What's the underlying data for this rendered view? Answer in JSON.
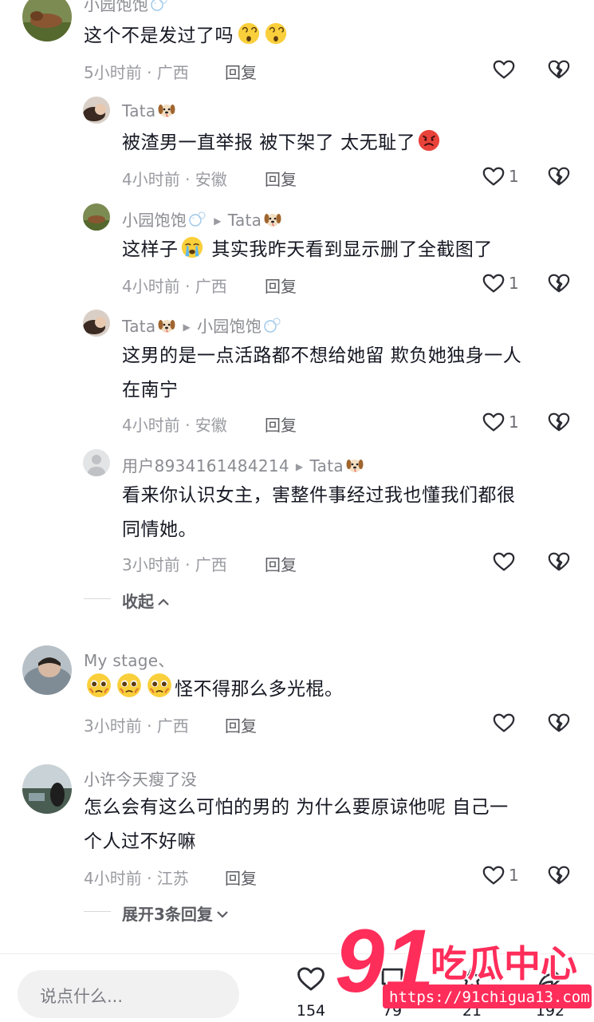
{
  "comments": [
    {
      "name": "小园饱饱",
      "text": "这个不是发过了吗",
      "time": "5小时前 · 广西",
      "reply": "回复"
    },
    {
      "name": "Tata",
      "text": "被渣男一直举报 被下架了 太无耻了",
      "time": "4小时前 · 安徽",
      "reply": "回复",
      "likes": "1"
    },
    {
      "name": "小园饱饱",
      "reply_to": "Tata",
      "text": "这样子",
      "text2": "其实我昨天看到显示删了全截图了",
      "time": "4小时前 · 广西",
      "reply": "回复",
      "likes": "1"
    },
    {
      "name": "Tata",
      "reply_to": "小园饱饱",
      "text_l1": "这男的是一点活路都不想给她留 欺负她独身一人",
      "text_l2": "在南宁",
      "time": "4小时前 · 安徽",
      "reply": "回复",
      "likes": "1"
    },
    {
      "name": "用户8934161484214",
      "reply_to": "Tata",
      "text_l1": "看来你认识女主，害整件事经过我也懂我们都很",
      "text_l2": "同情她。",
      "time": "3小时前 · 广西",
      "reply": "回复"
    },
    {
      "name": "My  stage、",
      "text": "怪不得那么多光棍。",
      "time": "3小时前 · 广西",
      "reply": "回复"
    },
    {
      "name": "小许今天瘦了没",
      "text_l1": "怎么会有这么可怕的男的 为什么要原谅他呢 自己一",
      "text_l2": "个人过不好嘛",
      "time": "4小时前 · 江苏",
      "reply": "回复",
      "likes": "1"
    }
  ],
  "collapse_label": "收起",
  "expand_label": "展开3条回复",
  "bottom": {
    "input_placeholder": "说点什么...",
    "like_count": "154",
    "comment_count": "79",
    "collect_count": "21",
    "share_count": "192"
  },
  "watermark": {
    "brand": "91吃瓜中心",
    "url": "https://91chigua13.com"
  },
  "icons": [
    "heart-icon",
    "broken-heart-icon",
    "chevron-up-icon",
    "chevron-down-icon",
    "default-avatar-icon"
  ]
}
